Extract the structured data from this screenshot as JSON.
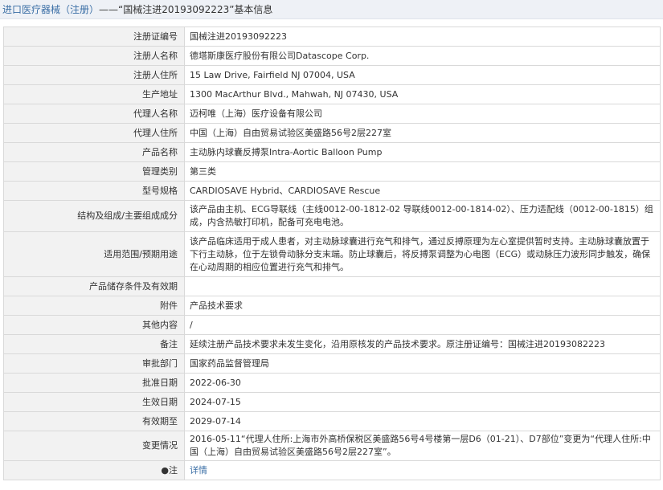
{
  "header": {
    "back_link": "进口医疗器械（注册）",
    "title": "——“国械注进20193092223”基本信息"
  },
  "rows": [
    {
      "label": "注册证编号",
      "value": "国械注进20193092223"
    },
    {
      "label": "注册人名称",
      "value": "德塔斯康医疗股份有限公司Datascope Corp."
    },
    {
      "label": "注册人住所",
      "value": "15 Law Drive, Fairfield NJ 07004, USA"
    },
    {
      "label": "生产地址",
      "value": "1300 MacArthur Blvd., Mahwah, NJ 07430, USA"
    },
    {
      "label": "代理人名称",
      "value": "迈柯唯（上海）医疗设备有限公司"
    },
    {
      "label": "代理人住所",
      "value": "中国（上海）自由贸易试验区美盛路56号2层227室"
    },
    {
      "label": "产品名称",
      "value": "主动脉内球囊反搏泵Intra-Aortic Balloon Pump"
    },
    {
      "label": "管理类别",
      "value": "第三类"
    },
    {
      "label": "型号规格",
      "value": "CARDIOSAVE Hybrid、CARDIOSAVE Rescue"
    },
    {
      "label": "结构及组成/主要组成成分",
      "value": "该产品由主机、ECG导联线（主线0012-00-1812-02 导联线0012-00-1814-02）、压力适配线（0012-00-1815）组成，内含热敏打印机，配备可充电电池。"
    },
    {
      "label": "适用范围/预期用途",
      "value": "该产品临床适用于成人患者，对主动脉球囊进行充气和排气，通过反搏原理为左心室提供暂时支持。主动脉球囊放置于下行主动脉，位于左锁骨动脉分支末端。防止球囊后，将反搏泵调整为心电图（ECG）或动脉压力波形同步触发，确保在心动周期的相应位置进行充气和排气。"
    },
    {
      "label": "产品储存条件及有效期",
      "value": ""
    },
    {
      "label": "附件",
      "value": "产品技术要求"
    },
    {
      "label": "其他内容",
      "value": "/"
    },
    {
      "label": "备注",
      "value": "延续注册产品技术要求未发生变化，沿用原核发的产品技术要求。原注册证编号：国械注进20193082223"
    },
    {
      "label": "审批部门",
      "value": "国家药品监督管理局"
    },
    {
      "label": "批准日期",
      "value": "2022-06-30"
    },
    {
      "label": "生效日期",
      "value": "2024-07-15"
    },
    {
      "label": "有效期至",
      "value": "2029-07-14"
    },
    {
      "label": "变更情况",
      "value": "2016-05-11“代理人住所:上海市外高桥保税区美盛路56号4号楼第一层D6（01-21）、D7部位”变更为“代理人住所:中国（上海）自由贸易试验区美盛路56号2层227室”。"
    },
    {
      "label": "●注",
      "value": "详情"
    }
  ]
}
